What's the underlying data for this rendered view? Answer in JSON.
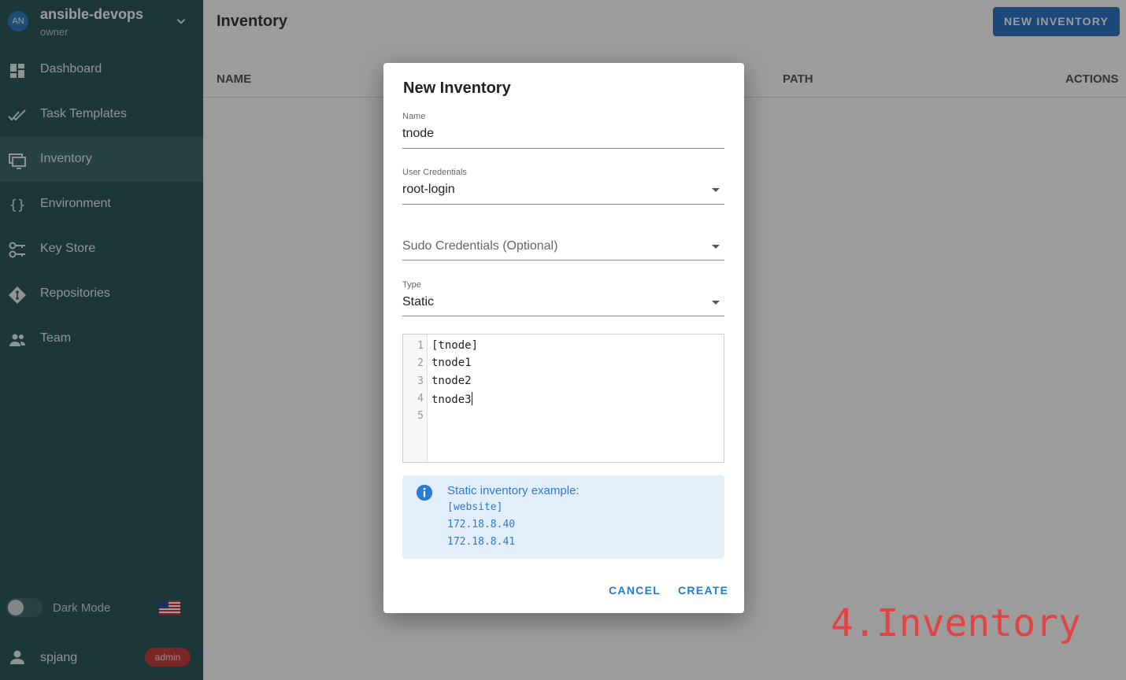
{
  "sidebar": {
    "avatar_initials": "AN",
    "project_name": "ansible-devops",
    "project_role": "owner",
    "items": [
      {
        "label": "Dashboard",
        "icon": "dashboard-icon"
      },
      {
        "label": "Task Templates",
        "icon": "double-check-icon"
      },
      {
        "label": "Inventory",
        "icon": "monitor-icon",
        "active": true
      },
      {
        "label": "Environment",
        "icon": "braces-icon"
      },
      {
        "label": "Key Store",
        "icon": "key-icon"
      },
      {
        "label": "Repositories",
        "icon": "git-icon"
      },
      {
        "label": "Team",
        "icon": "team-icon"
      }
    ],
    "dark_mode_label": "Dark Mode",
    "language_flag": "us-flag-icon",
    "username": "spjang",
    "user_badge": "admin"
  },
  "header": {
    "title": "Inventory",
    "new_button": "NEW INVENTORY"
  },
  "table": {
    "columns": [
      "NAME",
      "PATH",
      "ACTIONS"
    ]
  },
  "dialog": {
    "title": "New Inventory",
    "name_label": "Name",
    "name_value": "tnode",
    "user_cred_label": "User Credentials",
    "user_cred_value": "root-login",
    "sudo_placeholder": "Sudo Credentials (Optional)",
    "type_label": "Type",
    "type_value": "Static",
    "editor": {
      "line_numbers": [
        "1",
        "2",
        "3",
        "4",
        "5"
      ],
      "lines": [
        "[tnode]",
        "tnode1",
        "tnode2",
        "tnode3",
        ""
      ]
    },
    "info": {
      "title": "Static inventory example:",
      "lines": [
        "[website]",
        "172.18.8.40",
        "172.18.8.41"
      ]
    },
    "cancel": "CANCEL",
    "create": "CREATE"
  },
  "watermark": "4.Inventory",
  "colors": {
    "sidebar_bg": "#16484a",
    "primary": "#1565c0",
    "link": "#1e7bd6",
    "badge": "#c42a2a",
    "watermark": "#e04444"
  }
}
